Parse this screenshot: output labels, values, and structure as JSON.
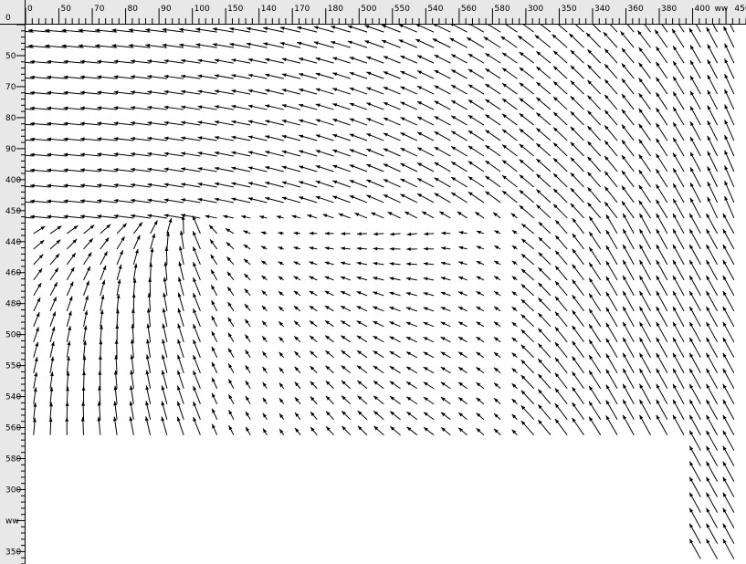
{
  "chart_data": {
    "type": "vector-field",
    "origin_label": "0",
    "x_ticks": [
      {
        "value": 0,
        "label": "0"
      },
      {
        "value": 50,
        "label": "50"
      },
      {
        "value": 100,
        "label": "70"
      },
      {
        "value": 150,
        "label": "80"
      },
      {
        "value": 200,
        "label": "90"
      },
      {
        "value": 250,
        "label": "100"
      },
      {
        "value": 300,
        "label": "150"
      },
      {
        "value": 350,
        "label": "140"
      },
      {
        "value": 400,
        "label": "170"
      },
      {
        "value": 450,
        "label": "180"
      },
      {
        "value": 500,
        "label": "500"
      },
      {
        "value": 550,
        "label": "550"
      },
      {
        "value": 600,
        "label": "540"
      },
      {
        "value": 650,
        "label": "560"
      },
      {
        "value": 700,
        "label": "580"
      },
      {
        "value": 750,
        "label": "300"
      },
      {
        "value": 800,
        "label": "350"
      },
      {
        "value": 850,
        "label": "340"
      },
      {
        "value": 900,
        "label": "360"
      },
      {
        "value": 950,
        "label": "380"
      },
      {
        "value": 1000,
        "label": "400"
      },
      {
        "value": 1030,
        "label": "ww"
      },
      {
        "value": 1060,
        "label": "450"
      }
    ],
    "y_ticks": [
      {
        "value": 50,
        "label": "50"
      },
      {
        "value": 100,
        "label": "70"
      },
      {
        "value": 150,
        "label": "80"
      },
      {
        "value": 200,
        "label": "90"
      },
      {
        "value": 250,
        "label": "400"
      },
      {
        "value": 300,
        "label": "450"
      },
      {
        "value": 350,
        "label": "440"
      },
      {
        "value": 400,
        "label": "460"
      },
      {
        "value": 450,
        "label": "480"
      },
      {
        "value": 500,
        "label": "500"
      },
      {
        "value": 550,
        "label": "550"
      },
      {
        "value": 600,
        "label": "540"
      },
      {
        "value": 650,
        "label": "560"
      },
      {
        "value": 700,
        "label": "580"
      },
      {
        "value": 750,
        "label": "300"
      },
      {
        "value": 800,
        "label": "ww"
      },
      {
        "value": 850,
        "label": "350"
      }
    ],
    "xlim": [
      0,
      1080
    ],
    "ylim": [
      0,
      870
    ],
    "grid_spacing": 25,
    "flow_model": "leftward-upward flow in the upper band, radial fan around a centre near (260, 290), blank region below 680",
    "colors": {
      "arrow": "#000000",
      "ruler_bg": "#e8e8e8",
      "ruler_line": "#000000"
    }
  }
}
